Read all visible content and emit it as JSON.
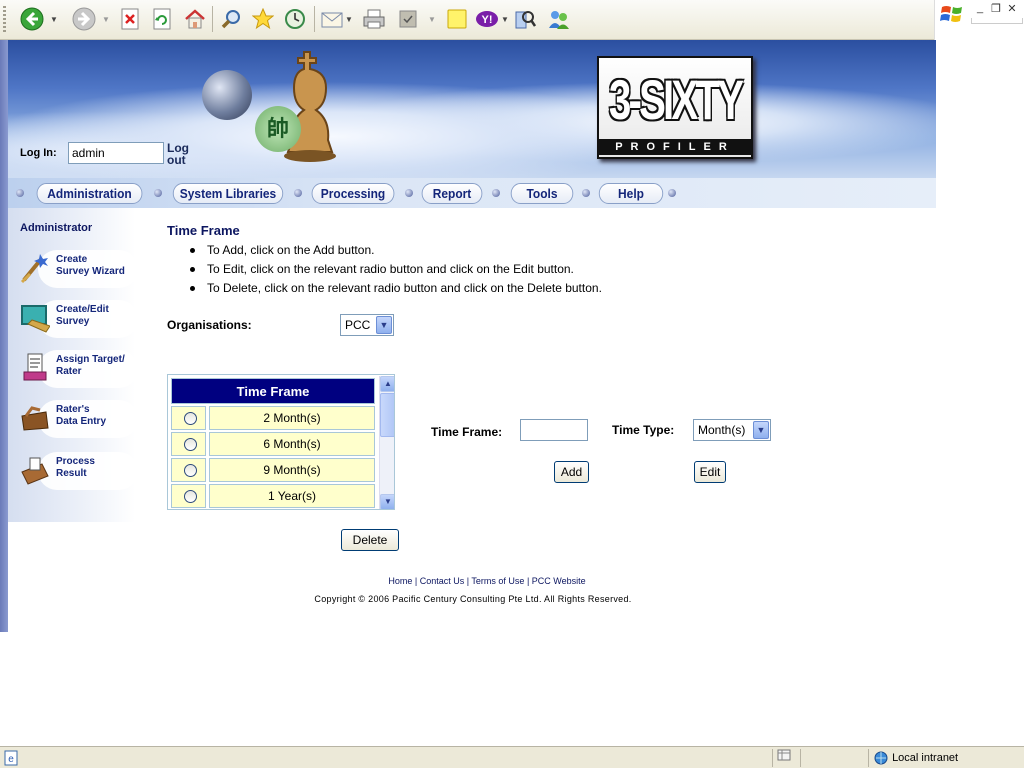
{
  "login": {
    "label": "Log In:",
    "username": "admin",
    "logout": "Log out"
  },
  "logo": {
    "title": "3-SIXTY",
    "subtitle": "PROFILER"
  },
  "badge_glyph": "帥",
  "nav": [
    {
      "label": "Administration"
    },
    {
      "label": "System Libraries"
    },
    {
      "label": "Processing"
    },
    {
      "label": "Report"
    },
    {
      "label": "Tools"
    },
    {
      "label": "Help"
    }
  ],
  "sidebar": {
    "title": "Administrator",
    "items": [
      {
        "line1": "Create",
        "line2": "Survey Wizard"
      },
      {
        "line1": "Create/Edit",
        "line2": "Survey"
      },
      {
        "line1": "Assign Target/",
        "line2": "Rater"
      },
      {
        "line1": "Rater's",
        "line2": "Data Entry"
      },
      {
        "line1": "Process",
        "line2": "Result"
      }
    ]
  },
  "content": {
    "title": "Time Frame",
    "instructions": [
      "To Add, click on the Add button.",
      "To Edit, click on the relevant radio button and click on the Edit button.",
      "To Delete, click on the relevant radio button and click on the Delete button."
    ],
    "org_label": "Organisations:",
    "org_value": "PCC",
    "table_header": "Time Frame",
    "rows": [
      "2 Month(s)",
      "6 Month(s)",
      "9 Month(s)",
      "1 Year(s)"
    ],
    "tf_label": "Time Frame:",
    "tt_label": "Time Type:",
    "tt_value": "Month(s)",
    "add": "Add",
    "edit": "Edit",
    "delete": "Delete"
  },
  "footer": {
    "links": [
      "Home",
      "Contact Us",
      "Terms of Use",
      "PCC Website"
    ],
    "copyright": "Copyright © 2006 Pacific Century Consulting Pte Ltd. All Rights Reserved."
  },
  "status": {
    "zone": "Local intranet"
  },
  "colors": {
    "nav_text": "#14267a",
    "table_header": "#000080",
    "row_bg": "#ffffcc"
  }
}
